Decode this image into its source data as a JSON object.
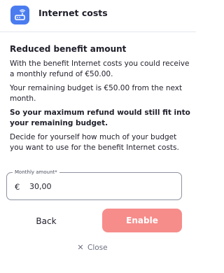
{
  "header": {
    "title": "Internet costs",
    "icon": "router-icon",
    "icon_color": "#4a7cf0"
  },
  "content": {
    "section_title": "Reduced benefit amount",
    "paragraph_1": "With the benefit Internet costs you could receive a monthly refund of €50.00.",
    "paragraph_2": "Your remaining budget is €50.00 from the next month.",
    "paragraph_3": "So your maximum refund would still fit into your remaining budget.",
    "paragraph_4": "Decide for yourself how much of your budget you want to use for the benefit Internet costs."
  },
  "amount_field": {
    "label": "Monthly amount*",
    "currency": "€",
    "value": "30,00"
  },
  "actions": {
    "back_label": "Back",
    "enable_label": "Enable",
    "enable_color": "#f68d8b",
    "close_label": "Close",
    "close_icon": "close-icon"
  }
}
